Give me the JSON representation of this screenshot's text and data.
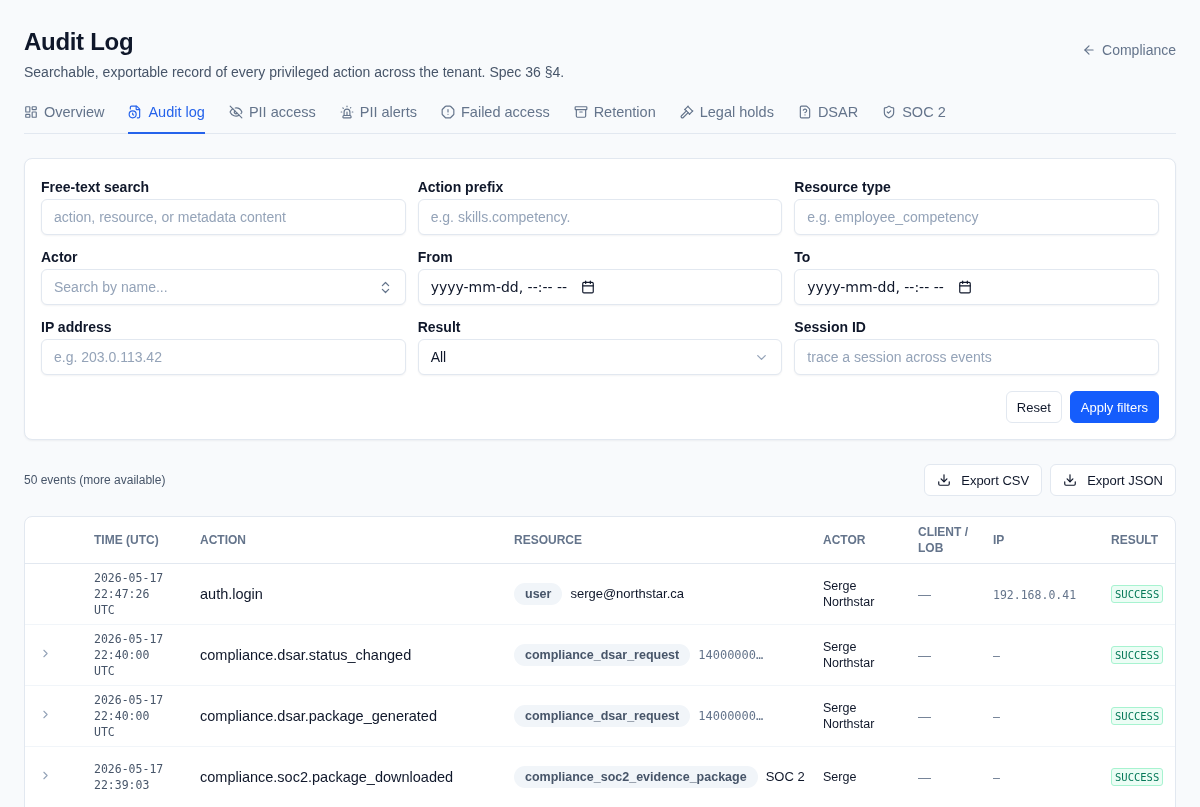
{
  "header": {
    "title": "Audit Log",
    "subtitle": "Searchable, exportable record of every privileged action across the tenant. Spec 36 §4.",
    "back_link": "Compliance"
  },
  "tabs": [
    {
      "label": "Overview",
      "selected": false
    },
    {
      "label": "Audit log",
      "selected": true
    },
    {
      "label": "PII access",
      "selected": false
    },
    {
      "label": "PII alerts",
      "selected": false
    },
    {
      "label": "Failed access",
      "selected": false
    },
    {
      "label": "Retention",
      "selected": false
    },
    {
      "label": "Legal holds",
      "selected": false
    },
    {
      "label": "DSAR",
      "selected": false
    },
    {
      "label": "SOC 2",
      "selected": false
    }
  ],
  "filters": {
    "fields": [
      {
        "label": "Free-text search",
        "kind": "text",
        "placeholder": "action, resource, or metadata content"
      },
      {
        "label": "Action prefix",
        "kind": "text",
        "placeholder": "e.g. skills.competency."
      },
      {
        "label": "Resource type",
        "kind": "text",
        "placeholder": "e.g. employee_competency"
      },
      {
        "label": "Actor",
        "kind": "combobox",
        "placeholder": "Search by name..."
      },
      {
        "label": "From",
        "kind": "date",
        "value": "yyyy-mm-dd, --:-- --"
      },
      {
        "label": "To",
        "kind": "date",
        "value": "yyyy-mm-dd, --:-- --"
      },
      {
        "label": "IP address",
        "kind": "text",
        "placeholder": "e.g. 203.0.113.42"
      },
      {
        "label": "Result",
        "kind": "select",
        "value": "All"
      },
      {
        "label": "Session ID",
        "kind": "text",
        "placeholder": "trace a session across events"
      }
    ],
    "buttons": [
      {
        "label": "Reset",
        "kind": "secondary"
      },
      {
        "label": "Apply filters",
        "kind": "primary"
      }
    ]
  },
  "summary": "50 events (more available)",
  "exports": [
    "Export CSV",
    "Export JSON"
  ],
  "table": {
    "columns": [
      "TIME (UTC)",
      "ACTION",
      "RESOURCE",
      "ACTOR",
      "CLIENT / LOB",
      "IP",
      "RESULT"
    ],
    "rows": [
      {
        "expandable": false,
        "time": [
          "2026-05-17",
          "22:47:26",
          "UTC"
        ],
        "action": "auth.login",
        "resource_type": "user",
        "resource_name": "serge@northstar.ca",
        "actor": [
          "Serge",
          "Northstar"
        ],
        "client": "—",
        "ip": "192.168.0.41",
        "result": "SUCCESS"
      },
      {
        "expandable": true,
        "time": [
          "2026-05-17",
          "22:40:00",
          "UTC"
        ],
        "action": "compliance.dsar.status_changed",
        "resource_type": "compliance_dsar_request",
        "resource_id": "14000000…",
        "actor": [
          "Serge",
          "Northstar"
        ],
        "client": "—",
        "ip": "–",
        "result": "SUCCESS"
      },
      {
        "expandable": true,
        "time": [
          "2026-05-17",
          "22:40:00",
          "UTC"
        ],
        "action": "compliance.dsar.package_generated",
        "resource_type": "compliance_dsar_request",
        "resource_id": "14000000…",
        "actor": [
          "Serge",
          "Northstar"
        ],
        "client": "—",
        "ip": "–",
        "result": "SUCCESS"
      },
      {
        "expandable": true,
        "time": [
          "2026-05-17",
          "22:39:03"
        ],
        "action": "compliance.soc2.package_downloaded",
        "resource_type": "compliance_soc2_evidence_package",
        "resource_name": "SOC 2",
        "actor": [
          "Serge"
        ],
        "client": "—",
        "ip": "–",
        "result": "SUCCESS"
      }
    ]
  }
}
